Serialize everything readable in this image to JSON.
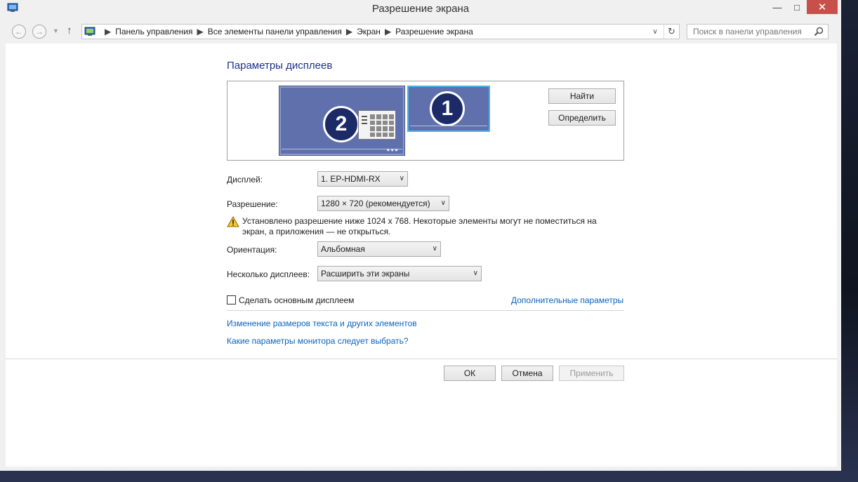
{
  "window": {
    "title": "Разрешение экрана"
  },
  "nav": {
    "breadcrumbs": [
      "Панель управления",
      "Все элементы панели управления",
      "Экран",
      "Разрешение экрана"
    ],
    "search_placeholder": "Поиск в панели управления"
  },
  "main": {
    "heading": "Параметры дисплеев",
    "monitors": {
      "primary_number": "1",
      "secondary_number": "2"
    },
    "find_button": "Найти",
    "identify_button": "Определить",
    "display": {
      "label": "Дисплей:",
      "value": "1. EP-HDMI-RX"
    },
    "resolution": {
      "label": "Разрешение:",
      "value": "1280 × 720 (рекомендуется)"
    },
    "warning": "Установлено разрешение ниже 1024 x 768. Некоторые элементы могут не поместиться на экран, а приложения — не открыться.",
    "orientation": {
      "label": "Ориентация:",
      "value": "Альбомная"
    },
    "multiple": {
      "label": "Несколько дисплеев:",
      "value": "Расширить эти экраны"
    },
    "make_main_label": "Сделать основным дисплеем",
    "advanced_link": "Дополнительные параметры",
    "resize_text_link": "Изменение размеров текста и других элементов",
    "which_settings_link": "Какие параметры монитора следует выбрать?"
  },
  "footer": {
    "ok": "ОК",
    "cancel": "Отмена",
    "apply": "Применить"
  },
  "colors": {
    "heading": "#1e3287",
    "link": "#0a64be",
    "monitor": "#5f70ad",
    "selected_border": "#4ab3f0",
    "close_button": "#c7504a"
  }
}
